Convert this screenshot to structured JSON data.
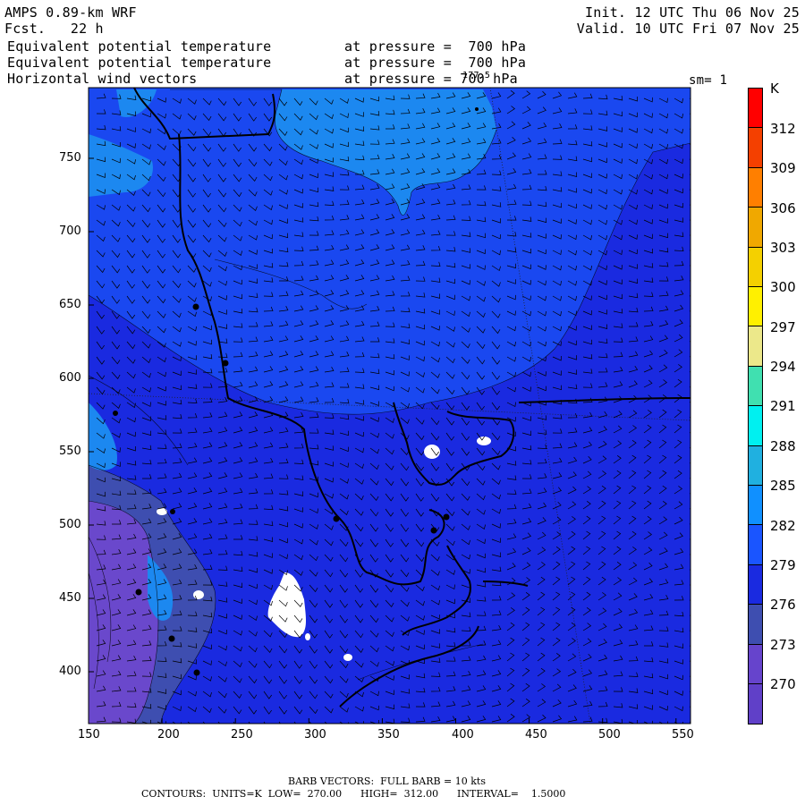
{
  "header": {
    "model": "AMPS 0.89-km WRF",
    "forecast": "Fcst.   22 h",
    "init": "Init. 12 UTC Thu 06 Nov 25",
    "valid": "Valid. 10 UTC Fri 07 Nov 25",
    "fields": [
      {
        "name": "Equivalent potential temperature",
        "level": "at pressure =  700 hPa"
      },
      {
        "name": "Equivalent potential temperature",
        "level": "at pressure =  700 hPa"
      },
      {
        "name": "Horizontal wind vectors",
        "level": "at pressure = 700 hPa"
      }
    ],
    "overlap_label": "177.5",
    "smoothing": "sm= 1"
  },
  "axes": {
    "x_ticks": [
      "150",
      "200",
      "250",
      "300",
      "350",
      "400",
      "450",
      "500",
      "550"
    ],
    "y_ticks": [
      "750",
      "700",
      "650",
      "600",
      "550",
      "500",
      "450",
      "400"
    ]
  },
  "colorbar": {
    "unit": "K",
    "labels": [
      "312",
      "309",
      "306",
      "303",
      "300",
      "297",
      "294",
      "291",
      "288",
      "285",
      "282",
      "279",
      "276",
      "273",
      "270"
    ],
    "colors": [
      "#ff0000",
      "#f44000",
      "#ff7f00",
      "#f0a800",
      "#f4d000",
      "#fff000",
      "#ece88a",
      "#40e0b0",
      "#00f0f0",
      "#20b0e0",
      "#1090ff",
      "#1a55ff",
      "#1a2ae0",
      "#3e4eb0",
      "#6644cc",
      "#6040c8"
    ]
  },
  "map_colors": {
    "level_273": "#3e4eb0",
    "level_276": "#1a2ae0",
    "level_279": "#1a48f0",
    "level_282": "#1c88f0",
    "level_270": "#6a48cc",
    "no_data": "#ffffff"
  },
  "footer": {
    "barb": "BARB VECTORS:  FULL BARB = 10 kts",
    "contours": "CONTOURS:  UNITS=K  LOW=  270.00      HIGH=  312.00      INTERVAL=    1.5000"
  }
}
